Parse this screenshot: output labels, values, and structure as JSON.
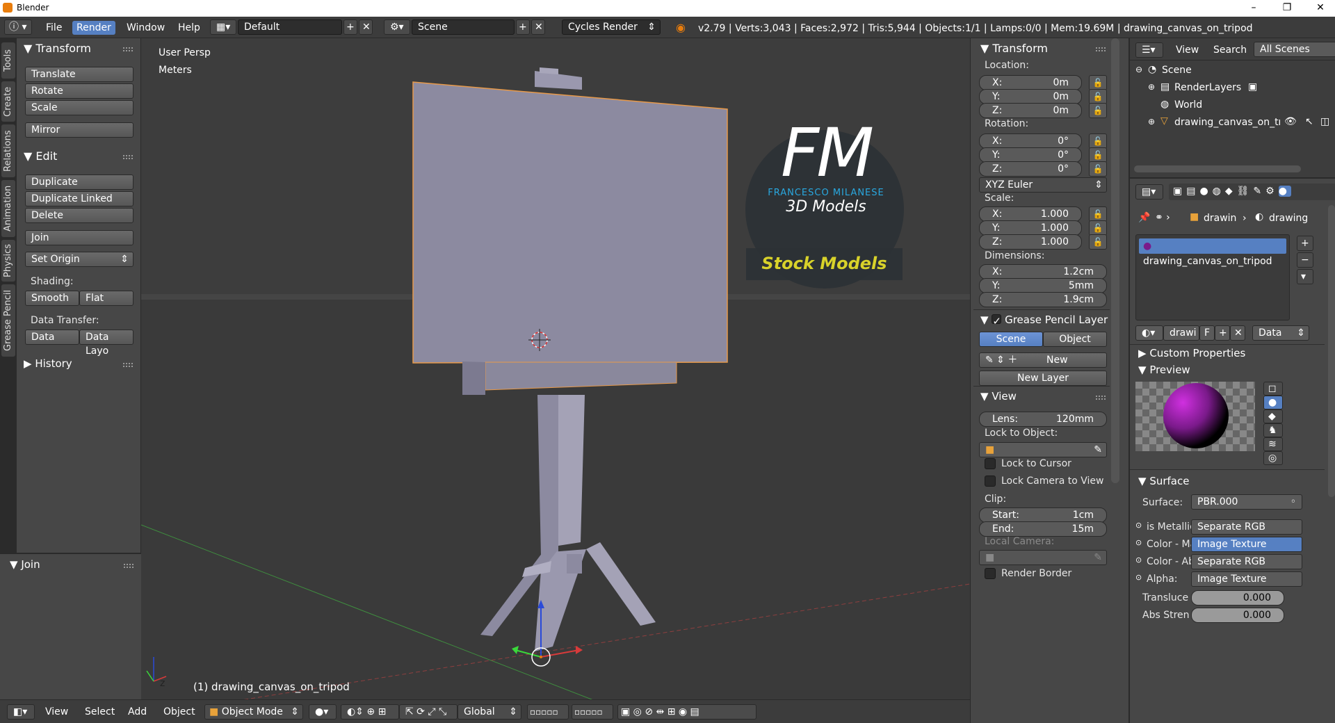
{
  "window": {
    "title": "Blender",
    "min": "–",
    "max": "❐",
    "close": "✕"
  },
  "menubar": {
    "items": [
      "File",
      "Render",
      "Window",
      "Help"
    ],
    "layout": "Default",
    "scene": "Scene",
    "engine": "Cycles Render",
    "stats": "v2.79 | Verts:3,043 | Faces:2,972 | Tris:5,944 | Objects:1/1 | Lamps:0/0 | Mem:19.69M | drawing_canvas_on_tripod"
  },
  "left_tabs": [
    "Tools",
    "Create",
    "Relations",
    "Animation",
    "Physics",
    "Grease Pencil"
  ],
  "tools": {
    "transform_header": "Transform",
    "translate": "Translate",
    "rotate": "Rotate",
    "scale": "Scale",
    "mirror": "Mirror",
    "edit_header": "Edit",
    "duplicate": "Duplicate",
    "duplicate_linked": "Duplicate Linked",
    "delete": "Delete",
    "join": "Join",
    "set_origin": "Set Origin",
    "shading_label": "Shading:",
    "smooth": "Smooth",
    "flat": "Flat",
    "data_transfer_label": "Data Transfer:",
    "data": "Data",
    "data_layo": "Data Layo",
    "history": "History",
    "op_panel": "Join"
  },
  "viewport": {
    "view_name": "User Persp",
    "units": "Meters",
    "object_label": "(1) drawing_canvas_on_tripod",
    "logo_initials": "FM",
    "logo_name": "FRANCESCO MILANESE",
    "logo_sub": "3D Models",
    "logo_banner": "Stock Models"
  },
  "bottombar": {
    "view": "View",
    "select": "Select",
    "add": "Add",
    "object": "Object",
    "mode": "Object Mode",
    "orientation": "Global"
  },
  "properties": {
    "transform_header": "Transform",
    "location_label": "Location:",
    "location": [
      {
        "k": "X:",
        "v": "0m"
      },
      {
        "k": "Y:",
        "v": "0m"
      },
      {
        "k": "Z:",
        "v": "0m"
      }
    ],
    "rotation_label": "Rotation:",
    "rotation": [
      {
        "k": "X:",
        "v": "0°"
      },
      {
        "k": "Y:",
        "v": "0°"
      },
      {
        "k": "Z:",
        "v": "0°"
      }
    ],
    "rotation_mode": "XYZ Euler",
    "scale_label": "Scale:",
    "scale": [
      {
        "k": "X:",
        "v": "1.000"
      },
      {
        "k": "Y:",
        "v": "1.000"
      },
      {
        "k": "Z:",
        "v": "1.000"
      }
    ],
    "dimensions_label": "Dimensions:",
    "dimensions": [
      {
        "k": "X:",
        "v": "1.2cm"
      },
      {
        "k": "Y:",
        "v": "5mm"
      },
      {
        "k": "Z:",
        "v": "1.9cm"
      }
    ],
    "gp_header": "Grease Pencil Layer",
    "gp_scene": "Scene",
    "gp_object": "Object",
    "gp_new": "New",
    "gp_new_layer": "New Layer",
    "view_header": "View",
    "lens": {
      "k": "Lens:",
      "v": "120mm"
    },
    "lock_object_label": "Lock to Object:",
    "lock_cursor": "Lock to Cursor",
    "lock_camera": "Lock Camera to View",
    "clip_label": "Clip:",
    "clip_start": {
      "k": "Start:",
      "v": "1cm"
    },
    "clip_end": {
      "k": "End:",
      "v": "15m"
    },
    "local_camera": "Local Camera:",
    "render_border": "Render Border"
  },
  "outliner": {
    "view": "View",
    "search": "Search",
    "filter": "All Scenes",
    "items": [
      "Scene",
      "RenderLayers",
      "World",
      "drawing_canvas_on_tri"
    ]
  },
  "material": {
    "crumb1": "drawin",
    "crumb2": "drawing",
    "slot": "drawing_canvas_on_tripod",
    "mat_name": "drawi",
    "f": "F",
    "link": "Data",
    "custom_props": "Custom Properties",
    "preview": "Preview",
    "surface_header": "Surface",
    "surface_label": "Surface:",
    "surface_value": "PBR.000",
    "inputs": [
      {
        "k": "is Metallic",
        "v": "Separate RGB"
      },
      {
        "k": "Color - Ma",
        "v": "Image Texture"
      },
      {
        "k": "Color - Ab",
        "v": "Separate RGB"
      },
      {
        "k": "Alpha:",
        "v": "Image Texture"
      }
    ],
    "transluce": {
      "k": "Transluce",
      "v": "0.000"
    },
    "abs_stren": {
      "k": "Abs Stren",
      "v": "0.000"
    }
  }
}
